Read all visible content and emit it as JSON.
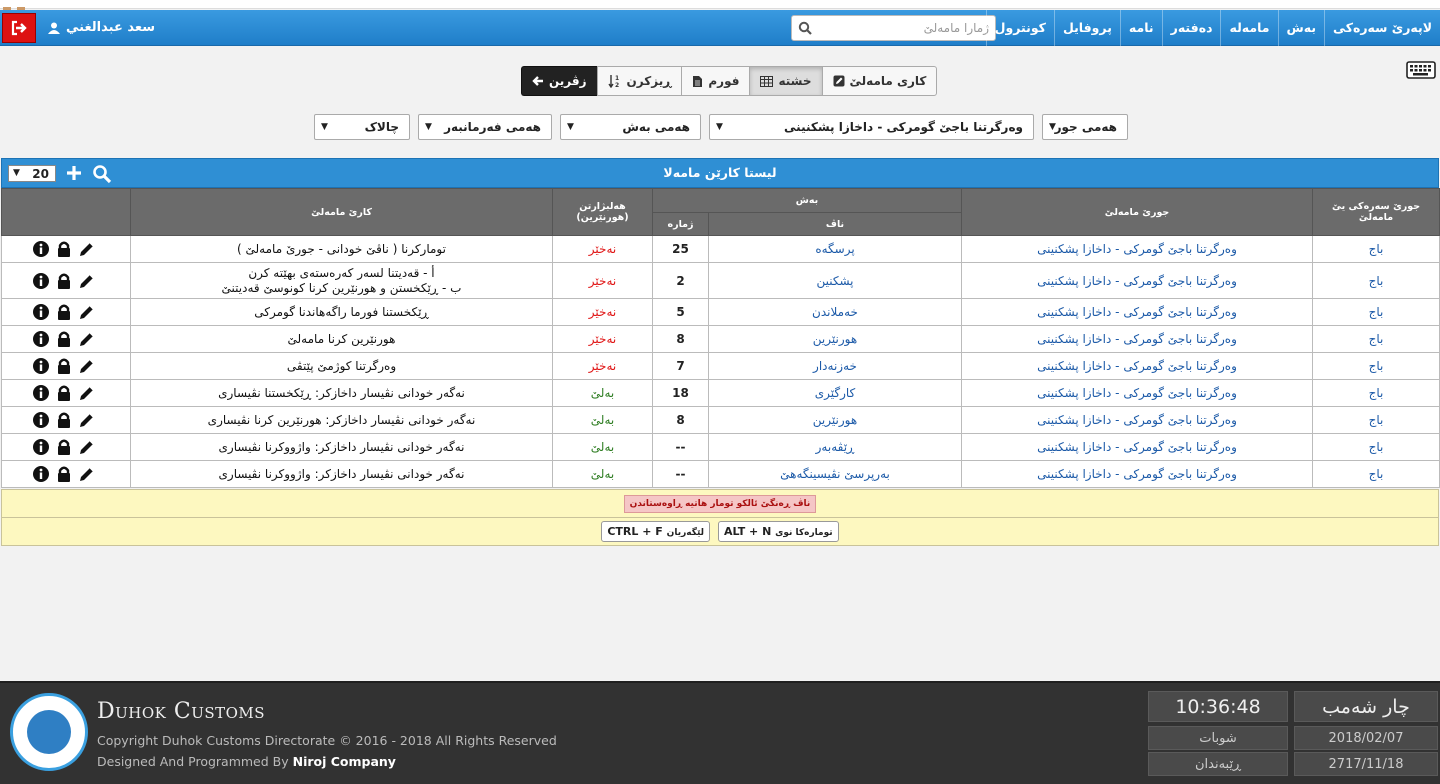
{
  "navbar": {
    "items": [
      "لاپەرێ سەرەکی",
      "بەش",
      "مامەلە",
      "دەفتەر",
      "نامە",
      "پروفایل",
      "کونترول"
    ],
    "search_placeholder": "ژمارا مامەلێ",
    "user_name": "سعد عبدالغني"
  },
  "tabs": {
    "back": "زڤرین",
    "sort": "ڕیزکرن",
    "form": "فورم",
    "table": "خشتە",
    "work": "کاری مامەلێ"
  },
  "filters": {
    "type": "هەمی جور",
    "transaction_type": "وەرگرتنا باجێ گومرکی - داخازا پشکنینی",
    "section": "هەمی بەش",
    "employee": "هەمی فەرمانبەر",
    "print": "چالاک"
  },
  "panel": {
    "title": "لیستا کارێن مامەلا",
    "page_size": "20"
  },
  "table": {
    "headers": {
      "main_type": "جورێ سەرەکی یێ مامەلێ",
      "transaction_type": "جورێ مامەلێ",
      "section": "بەش",
      "section_name": "ناڤ",
      "section_number": "ژمارە",
      "choice": "هەلبژارتن (هورنێرین)",
      "work": "کارێ مامەلێ"
    },
    "rows": [
      {
        "main": "باج",
        "type": "وەرگرتنا باجێ گومرکی - داخازا پشکنینی",
        "name": "پرسگەه",
        "num": "25",
        "choice": "نەخێر",
        "work": [
          "تومارکرنا ( ناڤێ خودانی - جورێ مامەلێ )"
        ]
      },
      {
        "main": "باج",
        "type": "وەرگرتنا باجێ گومرکی - داخازا پشکنینی",
        "name": "پشکنین",
        "num": "2",
        "choice": "نەخێر",
        "work": [
          "أ - قەدیتنا لسەر کەرەستەی بهێتە کرن",
          "ب - ڕێکخستن و هورنێرین کرنا کونوسێ قەدیتنێ"
        ]
      },
      {
        "main": "باج",
        "type": "وەرگرتنا باجێ گومرکی - داخازا پشکنینی",
        "name": "خەملاندن",
        "num": "5",
        "choice": "نەخێر",
        "work": [
          "ڕێکخستنا فورما راگەهاندنا گومرکی"
        ]
      },
      {
        "main": "باج",
        "type": "وەرگرتنا باجێ گومرکی - داخازا پشکنینی",
        "name": "هورنێرین",
        "num": "8",
        "choice": "نەخێر",
        "work": [
          "هورنێرین کرنا مامەلێ"
        ]
      },
      {
        "main": "باج",
        "type": "وەرگرتنا باجێ گومرکی - داخازا پشکنینی",
        "name": "خەزنەدار",
        "num": "7",
        "choice": "نەخێر",
        "work": [
          "وەرگرتنا کوژمێ پێتڤی"
        ]
      },
      {
        "main": "باج",
        "type": "وەرگرتنا باجێ گومرکی - داخازا پشکنینی",
        "name": "کارگێری",
        "num": "18",
        "choice": "بەلێ",
        "work": [
          "نەگەر خودانی نڤیسار داخازکر: ڕێکخستنا نڤیساری"
        ]
      },
      {
        "main": "باج",
        "type": "وەرگرتنا باجێ گومرکی - داخازا پشکنینی",
        "name": "هورنێرین",
        "num": "8",
        "choice": "بەلێ",
        "work": [
          "نەگەر خودانی نڤیسار داخازکر: هورنێرین کرنا نڤیساری"
        ]
      },
      {
        "main": "باج",
        "type": "وەرگرتنا باجێ گومرکی - داخازا پشکنینی",
        "name": "ڕێڤەبەر",
        "num": "--",
        "choice": "بەلێ",
        "work": [
          "نەگەر خودانی نڤیسار داخازکر: واژووکرنا نڤیساری"
        ]
      },
      {
        "main": "باج",
        "type": "وەرگرتنا باجێ گومرکی - داخازا پشکنینی",
        "name": "بەرپرسێ نڤیسینگەهێ",
        "num": "--",
        "choice": "بەلێ",
        "work": [
          "نەگەر خودانی نڤیسار داخازکر: واژووکرنا نڤیساری"
        ]
      }
    ]
  },
  "legend": {
    "red_note": "ناڤ ڕەنگێ ئالکو تومار هاتیە ڕاوەستاندن",
    "shortcut_new_key": "ALT + N",
    "shortcut_new_label": "تومارەکا نوی",
    "shortcut_search_key": "CTRL + F",
    "shortcut_search_label": "لێگەریان"
  },
  "footer": {
    "brand": "Duhok Customs",
    "copyright": "Copyright Duhok Customs Directorate © 2016 - 2018 All Rights Reserved",
    "designed_prefix": "Designed And Programmed By ",
    "designed_company": "Niroj Company",
    "day": "چار شەمب",
    "time": "10:36:48",
    "month_name": "شوبات",
    "date_gregorian": "2018/02/07",
    "kurdish_month": "ڕێبەندان",
    "date_kurdish": "2717/11/18"
  },
  "colors": {
    "nav_blue": "#1f7ec9",
    "panel_blue": "#2f8fd4",
    "header_gray": "#6b6b6b",
    "logout_red": "#dd1111",
    "no_red": "#e01414",
    "yes_green": "#2e7d22",
    "legend_yellow": "#fdf8c0"
  }
}
